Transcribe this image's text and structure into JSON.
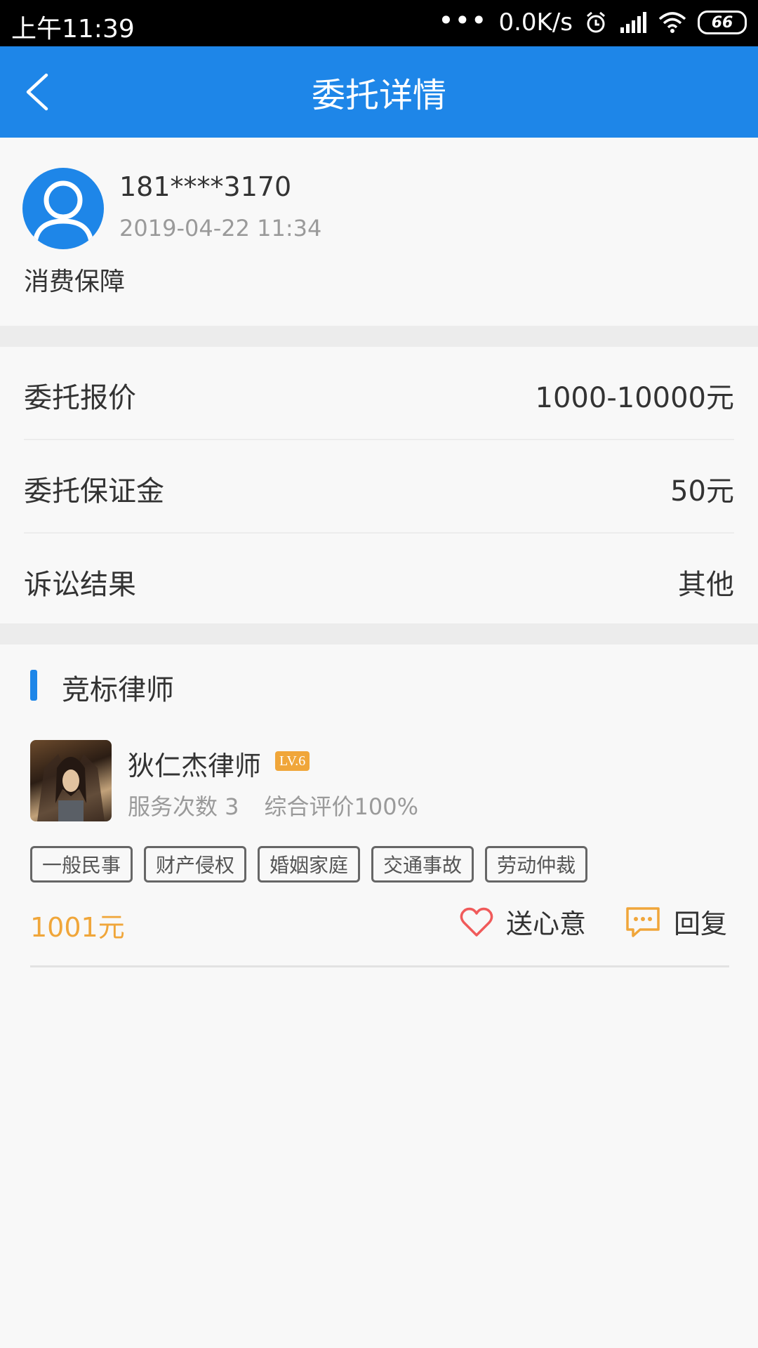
{
  "status_bar": {
    "time": "上午11:39",
    "net_speed": "0.0K/s",
    "battery": "66",
    "icons": [
      "more-dots-icon",
      "alarm-icon",
      "signal-icon",
      "wifi-icon",
      "battery-icon"
    ]
  },
  "app_bar": {
    "title": "委托详情",
    "back_icon": "chevron-left-icon",
    "color": "#1e86e8"
  },
  "user": {
    "phone": "181****3170",
    "date": "2019-04-22 11:34",
    "category": "消费保障"
  },
  "info": {
    "rows": [
      {
        "label": "委托报价",
        "value": "1000-10000元"
      },
      {
        "label": "委托保证金",
        "value": "50元"
      },
      {
        "label": "诉讼结果",
        "value": "其他"
      }
    ]
  },
  "lawyers": {
    "section_title": "竞标律师",
    "items": [
      {
        "name": "狄仁杰律师",
        "level": "LV.6",
        "service_count": "服务次数 3",
        "rating": "综合评价100%",
        "tags": [
          "一般民事",
          "财产侵权",
          "婚姻家庭",
          "交通事故",
          "劳动仲裁"
        ],
        "price": "1001元",
        "gift_label": "送心意",
        "reply_label": "回复"
      }
    ]
  },
  "colors": {
    "accent": "#1e86e8",
    "price": "#f0a63a",
    "heart": "#f05a5a",
    "reply_icon": "#f0a63a"
  }
}
